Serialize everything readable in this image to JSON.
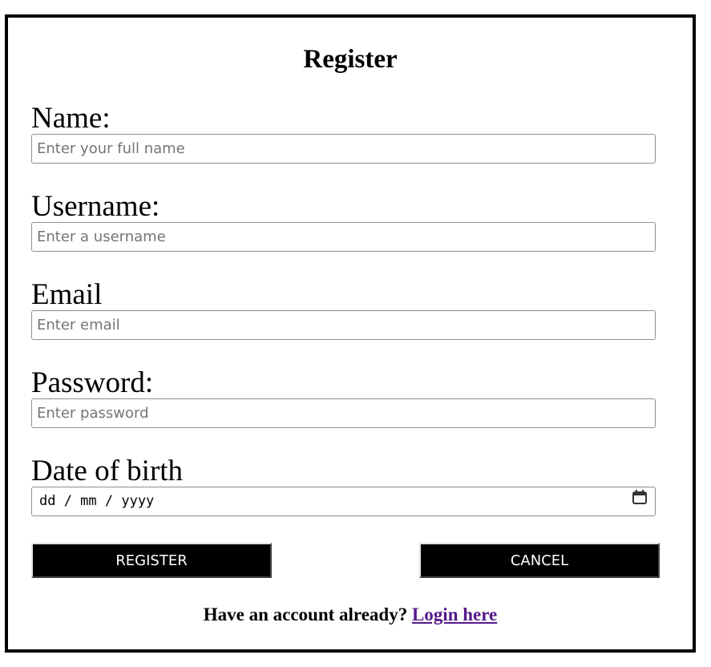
{
  "title": "Register",
  "fields": [
    {
      "label": "Name:",
      "placeholder": "Enter your full name"
    },
    {
      "label": "Username:",
      "placeholder": "Enter a username"
    },
    {
      "label": "Email",
      "placeholder": "Enter email"
    },
    {
      "label": "Password:",
      "placeholder": "Enter password"
    }
  ],
  "dob": {
    "label": "Date of birth",
    "placeholder": "dd / mm / yyyy",
    "icon": "calendar-icon"
  },
  "buttons": {
    "register": "REGISTER",
    "cancel": "CANCEL"
  },
  "footer": {
    "text": "Have an account already?",
    "link": "Login here"
  },
  "colors": {
    "link": "#551a8b",
    "button_bg": "#000000"
  }
}
